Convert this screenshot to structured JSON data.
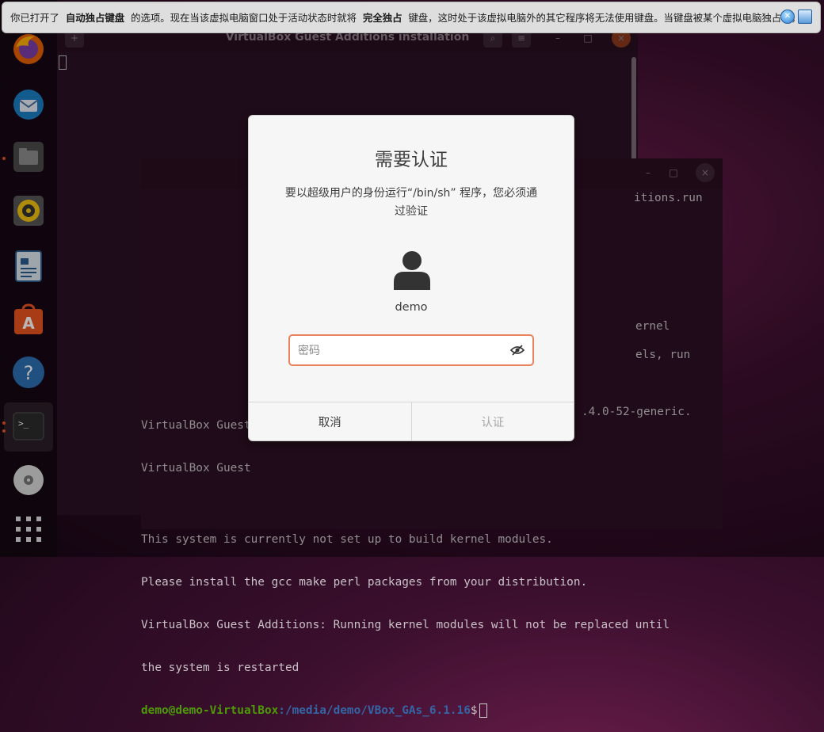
{
  "notice": {
    "part1": "你已打开了",
    "bold1": "自动独占键盘",
    "part2": "的选项。现在当该虚拟电脑窗口处于活动状态时就将",
    "bold2": "完全独占",
    "part3": "键盘，这时处于该虚拟电脑外的其它程序将无法使用键盘。当键盘被某个虚拟电脑独占时，",
    "close_icon": "close-icon",
    "info_icon": "message-icon"
  },
  "main_terminal": {
    "title": "VirtualBox Guest Additions installation"
  },
  "second_terminal": {
    "fragments": {
      "run_file": "itions.run",
      "kernel": "ernel",
      "els_run": "els, run",
      "generic": ".4.0-52-generic."
    },
    "lines": [
      "VirtualBox Guest",
      "VirtualBox Guest",
      "",
      "This system is currently not set up to build kernel modules.",
      "Please install the gcc make perl packages from your distribution.",
      "VirtualBox Guest Additions: Running kernel modules will not be replaced until",
      "the system is restarted"
    ],
    "prompt_user": "demo@demo-VirtualBox",
    "prompt_path": ":/media/demo/VBox_GAs_6.1.16",
    "prompt_symbol": "$"
  },
  "dialog": {
    "title": "需要认证",
    "message": "要以超级用户的身份运行“/bin/sh” 程序，您必须通过验证",
    "username": "demo",
    "password_placeholder": "密码",
    "cancel_label": "取消",
    "auth_label": "认证"
  },
  "dock": {
    "items": [
      "firefox-icon",
      "thunderbird-icon",
      "files-icon",
      "rhythmbox-icon",
      "writer-icon",
      "software-icon",
      "help-icon",
      "terminal-icon",
      "dvd-icon",
      "app-grid-icon"
    ]
  },
  "colors": {
    "accent": "#e95420",
    "prompt_user": "#4e9a06",
    "prompt_path": "#3465a4"
  }
}
